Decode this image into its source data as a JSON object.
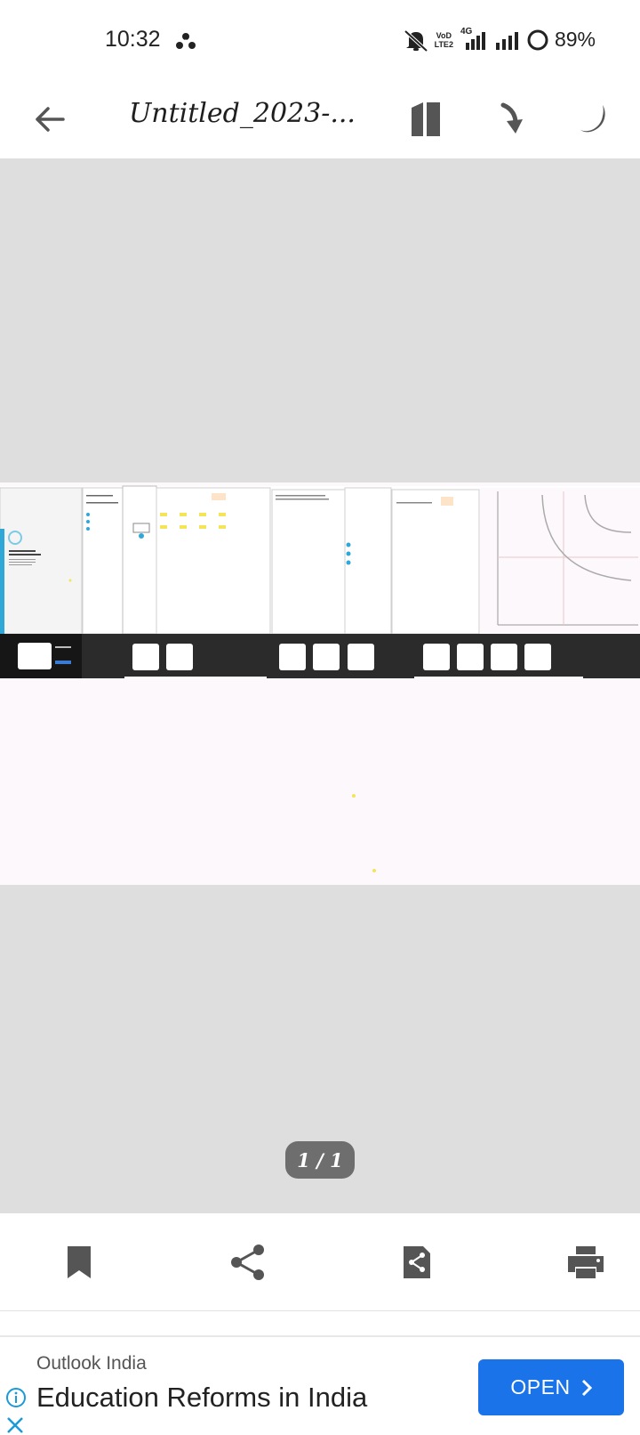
{
  "status_bar": {
    "time": "10:32",
    "volte_line1": "VoD",
    "volte_line2": "LTE2",
    "network_type": "4G",
    "battery": "89%"
  },
  "app_bar": {
    "title": "Untitled_2023-...",
    "icons": [
      "back-arrow-icon",
      "reading-mode-icon",
      "go-to-page-icon",
      "night-mode-icon"
    ]
  },
  "viewer": {
    "page_indicator": "1 / 1",
    "background_color": "#dedede",
    "page_color": "#fdf8fb"
  },
  "toolbar": {
    "icons": [
      "bookmark-icon",
      "share-icon",
      "share-file-icon",
      "print-icon"
    ]
  },
  "ad": {
    "source": "Outlook India",
    "headline": "Education Reforms in India",
    "cta": "OPEN",
    "cta_color": "#1a73e8"
  }
}
